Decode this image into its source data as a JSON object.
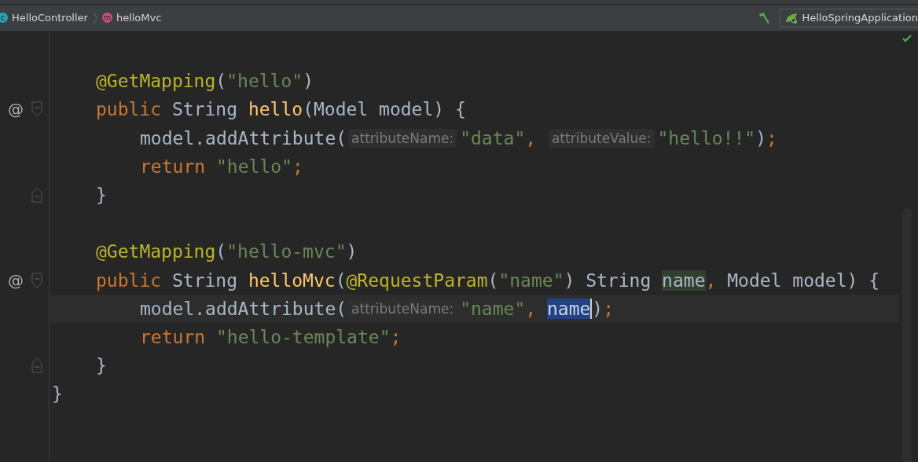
{
  "breadcrumbs": [
    {
      "badge": "c",
      "label": "HelloController",
      "color": "#2aa4b8"
    },
    {
      "badge": "m",
      "label": "helloMvc",
      "color": "#c9547a"
    }
  ],
  "run_config": {
    "label": "HelloSpringApplication"
  },
  "editor": {
    "lines": [
      {
        "kind": "blank"
      },
      {
        "kind": "member",
        "tokens": [
          {
            "kind": "annotation",
            "text": "@GetMapping"
          },
          {
            "kind": "plain",
            "text": "("
          },
          {
            "kind": "string",
            "text": "\"hello\""
          },
          {
            "kind": "plain",
            "text": ")"
          }
        ]
      },
      {
        "kind": "member",
        "gutter": "@",
        "fold_start": true,
        "tokens": [
          {
            "kind": "keyword",
            "text": "public "
          },
          {
            "kind": "plain",
            "text": "String "
          },
          {
            "kind": "method",
            "text": "hello"
          },
          {
            "kind": "plain",
            "text": "(Model model) {"
          }
        ]
      },
      {
        "kind": "body",
        "tokens": [
          {
            "kind": "plain",
            "text": "model.addAttribute("
          },
          {
            "kind": "hint",
            "text": "attributeName:"
          },
          {
            "kind": "string",
            "text": "\"data\""
          },
          {
            "kind": "keyword",
            "text": ", "
          },
          {
            "kind": "hint",
            "text": "attributeValue:"
          },
          {
            "kind": "string",
            "text": "\"hello!!\""
          },
          {
            "kind": "plain",
            "text": ")"
          },
          {
            "kind": "keyword",
            "text": ";"
          }
        ]
      },
      {
        "kind": "body",
        "tokens": [
          {
            "kind": "keyword",
            "text": "return "
          },
          {
            "kind": "string",
            "text": "\"hello\""
          },
          {
            "kind": "keyword",
            "text": ";"
          }
        ]
      },
      {
        "kind": "member",
        "fold_end": true,
        "tokens": [
          {
            "kind": "plain",
            "text": "}"
          }
        ]
      },
      {
        "kind": "blank"
      },
      {
        "kind": "member",
        "tokens": [
          {
            "kind": "annotation",
            "text": "@GetMapping"
          },
          {
            "kind": "plain",
            "text": "("
          },
          {
            "kind": "string",
            "text": "\"hello-mvc\""
          },
          {
            "kind": "plain",
            "text": ")"
          }
        ]
      },
      {
        "kind": "member",
        "gutter": "@",
        "fold_start": true,
        "tokens": [
          {
            "kind": "keyword",
            "text": "public "
          },
          {
            "kind": "plain",
            "text": "String "
          },
          {
            "kind": "method",
            "text": "helloMvc"
          },
          {
            "kind": "plain",
            "text": "("
          },
          {
            "kind": "annotation",
            "text": "@RequestParam"
          },
          {
            "kind": "plain",
            "text": "("
          },
          {
            "kind": "string",
            "text": "\"name\""
          },
          {
            "kind": "plain",
            "text": ") String "
          },
          {
            "kind": "usage",
            "text": "name"
          },
          {
            "kind": "keyword",
            "text": ", "
          },
          {
            "kind": "plain",
            "text": "Model model) {"
          }
        ]
      },
      {
        "kind": "body",
        "current": true,
        "tokens": [
          {
            "kind": "plain",
            "text": "model.addAttribute("
          },
          {
            "kind": "hint",
            "text": "attributeName:"
          },
          {
            "kind": "string",
            "text": "\"name\""
          },
          {
            "kind": "keyword",
            "text": ", "
          },
          {
            "kind": "selected",
            "text": "name",
            "caret": true
          },
          {
            "kind": "plain",
            "text": ")"
          },
          {
            "kind": "keyword",
            "text": ";"
          }
        ]
      },
      {
        "kind": "body",
        "tokens": [
          {
            "kind": "keyword",
            "text": "return "
          },
          {
            "kind": "string",
            "text": "\"hello-template\""
          },
          {
            "kind": "keyword",
            "text": ";"
          }
        ]
      },
      {
        "kind": "member",
        "fold_end": true,
        "tokens": [
          {
            "kind": "plain",
            "text": "}"
          }
        ]
      },
      {
        "kind": "class",
        "tokens": [
          {
            "kind": "plain",
            "text": "}"
          }
        ]
      }
    ]
  }
}
